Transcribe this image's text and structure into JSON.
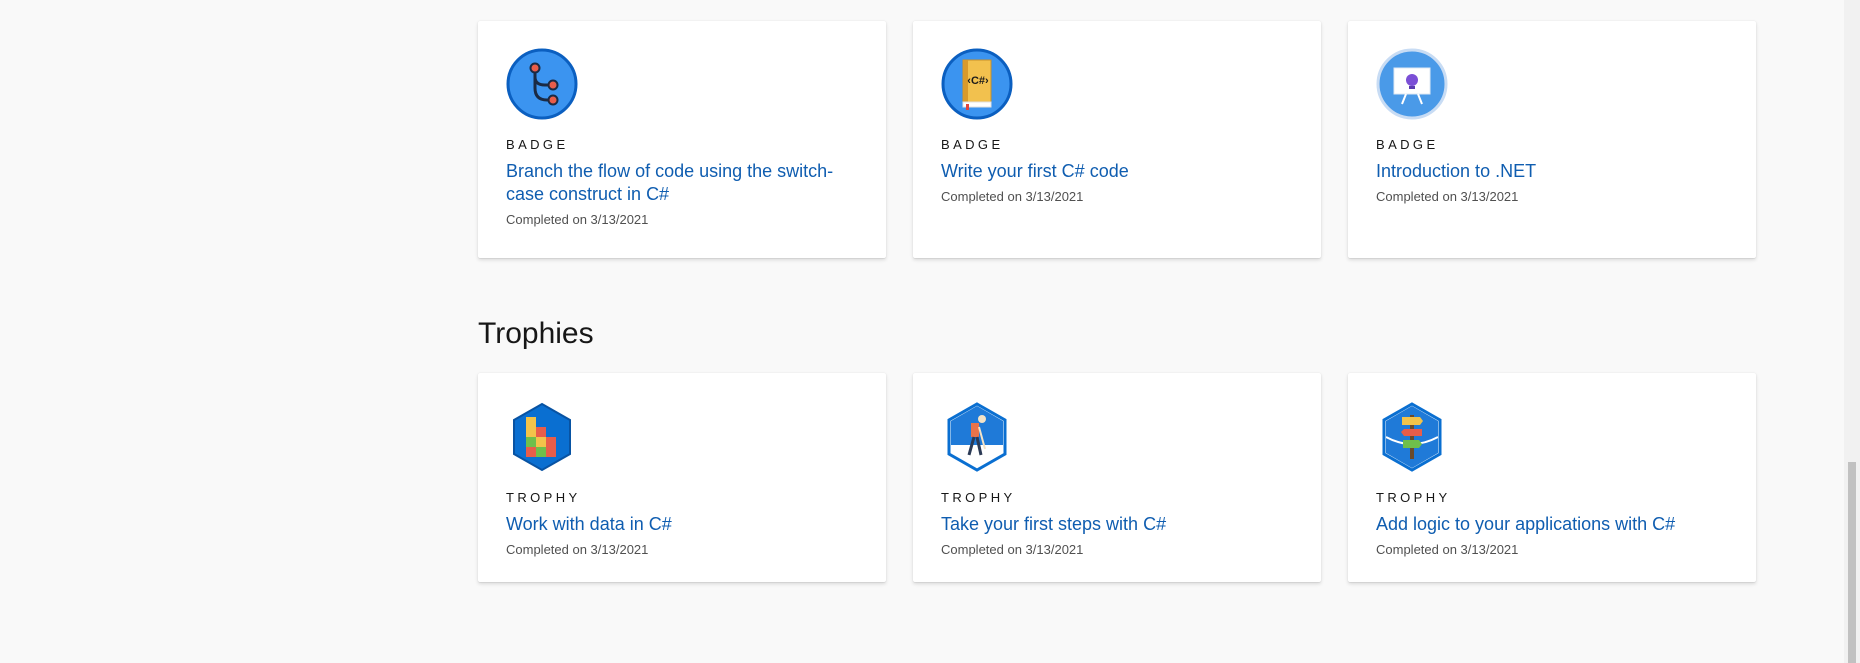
{
  "badges": [
    {
      "kicker": "BADGE",
      "title": "Branch the flow of code using the switch-case construct in C#",
      "completed": "Completed on 3/13/2021",
      "icon": "branch-flow-icon"
    },
    {
      "kicker": "BADGE",
      "title": "Write your first C# code",
      "completed": "Completed on 3/13/2021",
      "icon": "csharp-book-icon"
    },
    {
      "kicker": "BADGE",
      "title": "Introduction to .NET",
      "completed": "Completed on 3/13/2021",
      "icon": "dotnet-presentation-icon"
    }
  ],
  "trophies_section": {
    "title": "Trophies"
  },
  "trophies": [
    {
      "kicker": "TROPHY",
      "title": "Work with data in C#",
      "completed": "Completed on 3/13/2021",
      "icon": "data-blocks-icon"
    },
    {
      "kicker": "TROPHY",
      "title": "Take your first steps with C#",
      "completed": "Completed on 3/13/2021",
      "icon": "hiker-icon"
    },
    {
      "kicker": "TROPHY",
      "title": "Add logic to your applications with C#",
      "completed": "Completed on 3/13/2021",
      "icon": "signpost-icon"
    }
  ],
  "colors": {
    "link": "#0f5db0",
    "badge_blue": "#1e88e5",
    "trophy_blue": "#0a6fd1",
    "background": "#f9f9f9"
  }
}
